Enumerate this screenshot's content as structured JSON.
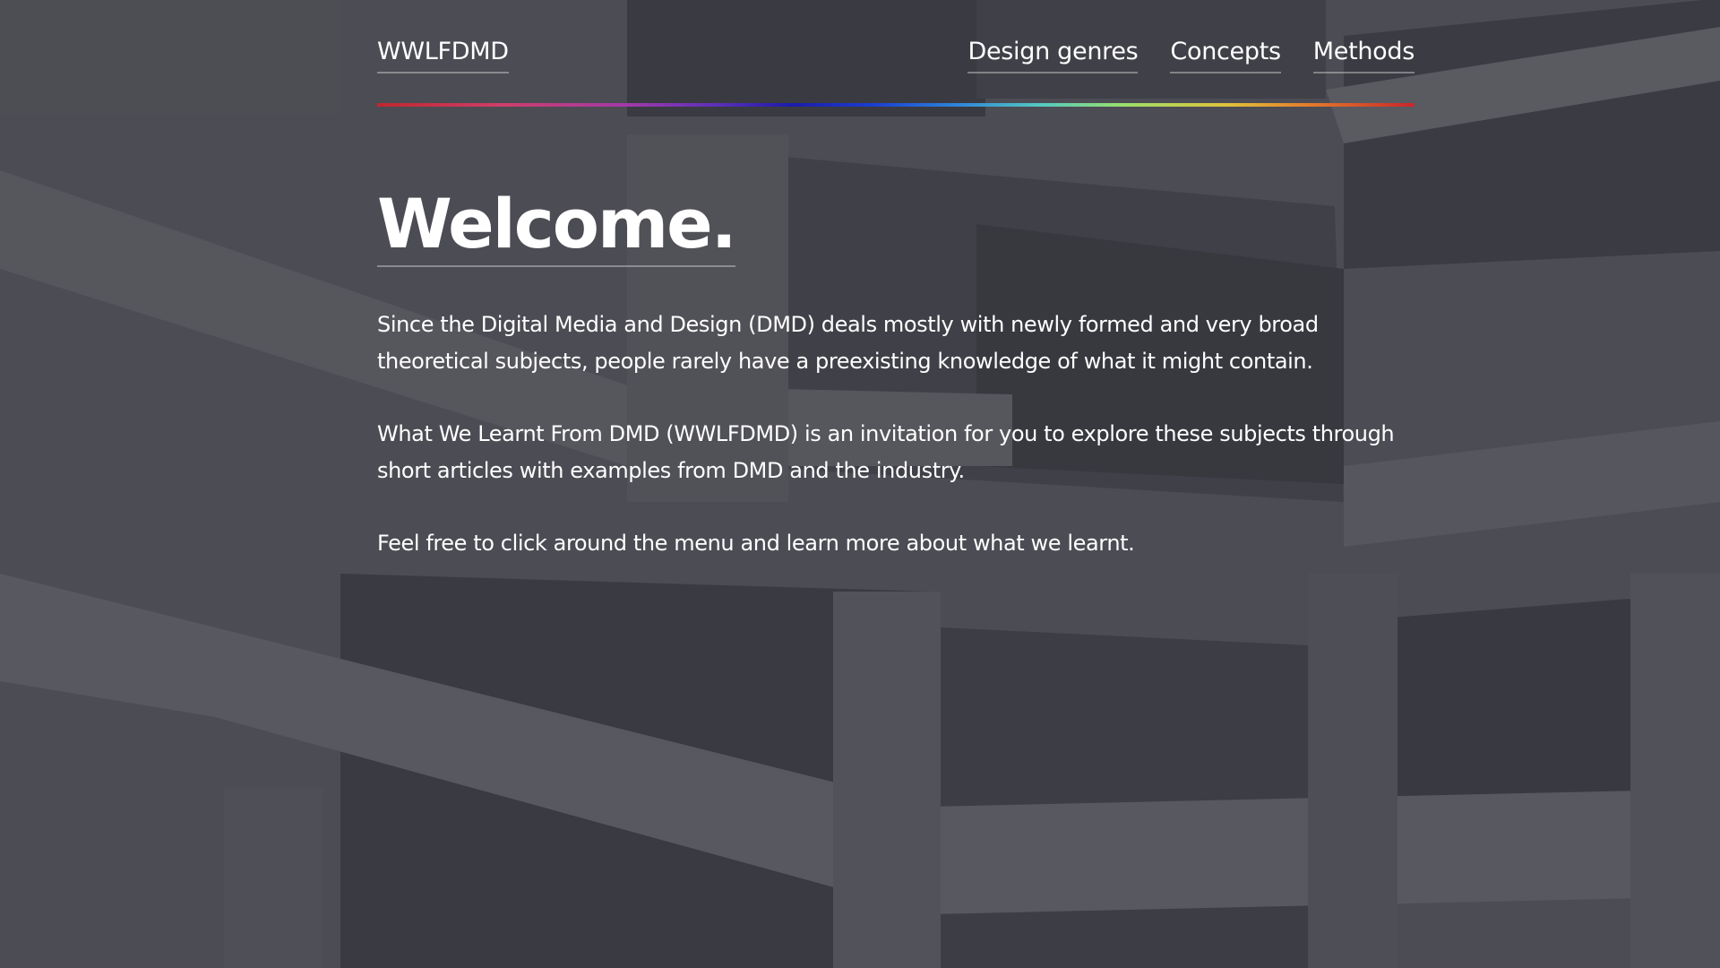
{
  "site": {
    "brand": "WWLFDMD"
  },
  "nav": {
    "items": [
      {
        "label": "Design genres"
      },
      {
        "label": "Concepts"
      },
      {
        "label": "Methods"
      }
    ]
  },
  "hero": {
    "title": "Welcome.",
    "paragraphs": [
      "Since the Digital Media and Design (DMD) deals mostly with newly formed and very broad theoretical subjects, people rarely have a preexisting knowledge of what it might contain.",
      "What We Learnt From DMD (WWLFDMD) is an invitation for you to explore these subjects through short articles with examples from DMD and the industry.",
      "Feel free to click around the menu and learn more about what we learnt."
    ]
  },
  "colors": {
    "background": "#46464c",
    "text": "#ffffff",
    "divider_gradient": [
      "#c0272d",
      "#a23aa8",
      "#1c1ca8",
      "#55c9c0",
      "#e0c23a",
      "#c8262b"
    ]
  }
}
